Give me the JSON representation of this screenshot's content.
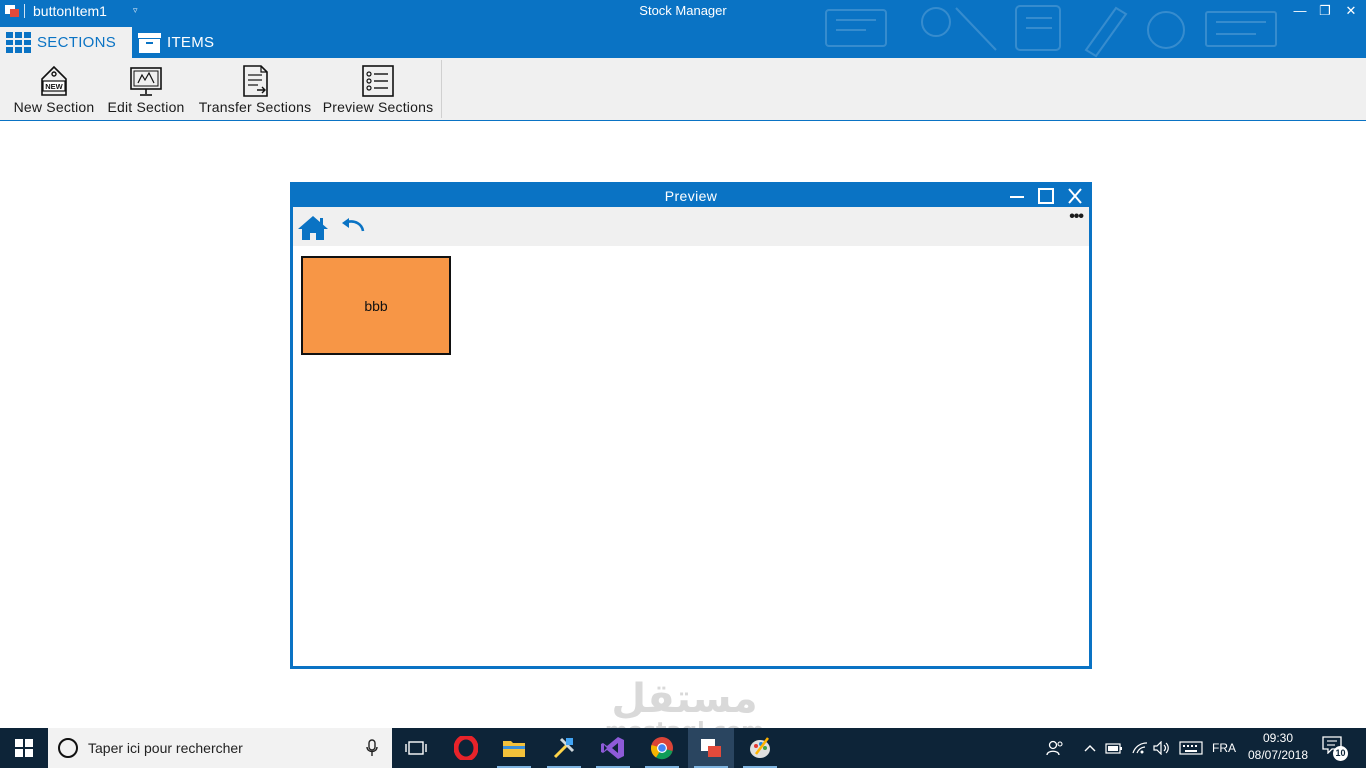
{
  "titlebar": {
    "quick_access_title": "buttonItem1",
    "quick_access_dropdown": "▿",
    "window_title": "Stock Manager",
    "controls": {
      "minimize": "—",
      "restore": "❐",
      "close": "✕"
    }
  },
  "tabs": [
    {
      "label": "SECTIONS",
      "icon": "grid-icon",
      "active": true
    },
    {
      "label": "ITEMS",
      "icon": "box-icon",
      "active": false
    }
  ],
  "ribbon": {
    "buttons": [
      {
        "label": "New Section",
        "icon": "new-tag-icon"
      },
      {
        "label": "Edit Section",
        "icon": "edit-monitor-icon"
      },
      {
        "label": "Transfer Sections",
        "icon": "document-transfer-icon"
      },
      {
        "label": "Preview Sections",
        "icon": "checklist-icon"
      }
    ]
  },
  "preview": {
    "title": "Preview",
    "more": "•••",
    "toolbar": {
      "home_icon": "home-icon",
      "back_icon": "undo-icon"
    },
    "sections": [
      {
        "name": "bbb",
        "color": "#f79646"
      }
    ]
  },
  "watermark": {
    "arabic": "مستقل",
    "latin": "mostaql.com"
  },
  "taskbar": {
    "search_placeholder": "Taper ici pour rechercher",
    "apps": [
      "task-view-icon",
      "opera-icon",
      "file-explorer-icon",
      "tools-icon",
      "visual-studio-icon",
      "chrome-icon",
      "stock-manager-icon",
      "paint-icon"
    ],
    "tray": {
      "language": "FRA"
    },
    "clock": {
      "time": "09:30",
      "date": "08/07/2018"
    },
    "notifications_count": "10"
  },
  "colors": {
    "accent": "#0a73c4",
    "ribbon_bg": "#f0f0f0",
    "section_card": "#f79646",
    "taskbar": "#0d2438"
  }
}
